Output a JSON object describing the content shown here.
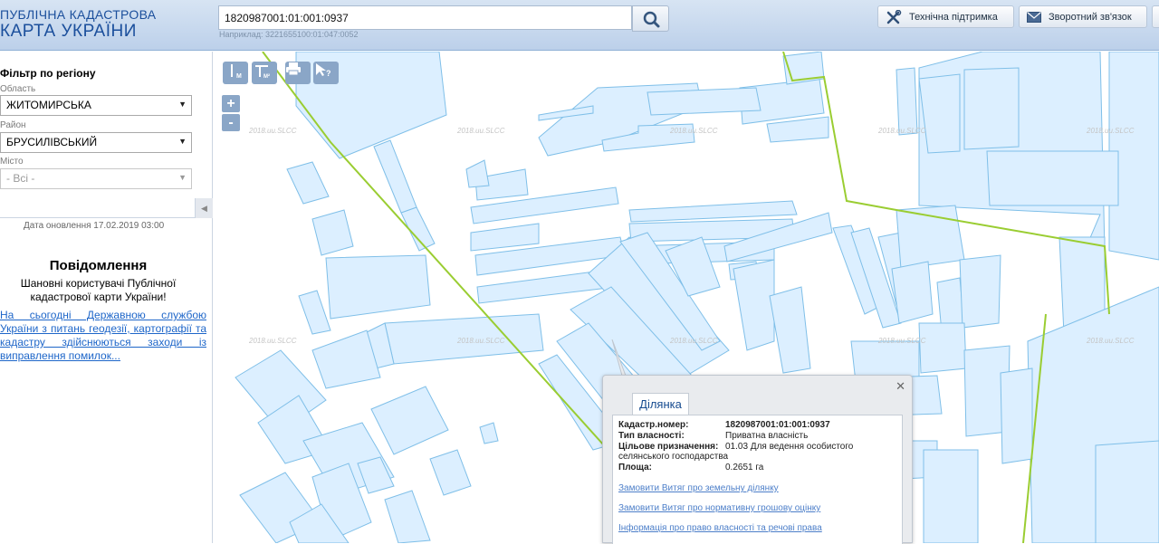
{
  "header": {
    "logo_line1": "ПУБЛІЧНА КАДАСТРОВА",
    "logo_line2": "КАРТА УКРАЇНИ",
    "search_value": "1820987001:01:001:0937",
    "search_hint": "Наприклад: 3221655100:01:047:0052",
    "support_label": "Технічна підтримка",
    "feedback_label": "Зворотний зв'язок"
  },
  "sidebar": {
    "filter_title": "Фільтр по регіону",
    "region_label": "Область",
    "region_value": "ЖИТОМИРСЬКА",
    "district_label": "Район",
    "district_value": "БРУСИЛІВСЬКИЙ",
    "city_label": "Місто",
    "city_value": "- Всі -",
    "update_date": "Дата оновлення  17.02.2019 03:00",
    "notice_title": "Повідомлення",
    "notice_text": "Шановні користувачі Публічної кадастрової карти України!",
    "notice_link": "На сьогодні Державною службою України з питань геодезії, картографії та кадастру здійснюються заходи із виправлення помилок..."
  },
  "map": {
    "watermark": "2018.uu.SLCC",
    "tools": {
      "ruler": "M",
      "area": "M²",
      "print": "print",
      "identify": "?"
    },
    "zoom_in": "+",
    "zoom_out": "-"
  },
  "popup": {
    "tab": "Ділянка",
    "props": [
      {
        "key": "Кадастр.номер:",
        "value": "1820987001:01:001:0937"
      },
      {
        "key": "Тип власності:",
        "value": "Приватна власність"
      },
      {
        "key": "Цільове призначення:",
        "value": "01.03 Для ведення особистого"
      },
      {
        "key": "селянського господарства",
        "value": ""
      },
      {
        "key": "Площа:",
        "value": "0.2651 га"
      }
    ],
    "links": [
      "Замовити Витяг про земельну ділянку",
      "Замовити Витяг про нормативну грошову оцінку",
      "Інформація про право власності та речові права"
    ]
  },
  "colors": {
    "parcel_fill": "#dcefff",
    "parcel_stroke": "#7fbfe8",
    "boundary": "#9acd32",
    "brand": "#1b4f9c"
  }
}
